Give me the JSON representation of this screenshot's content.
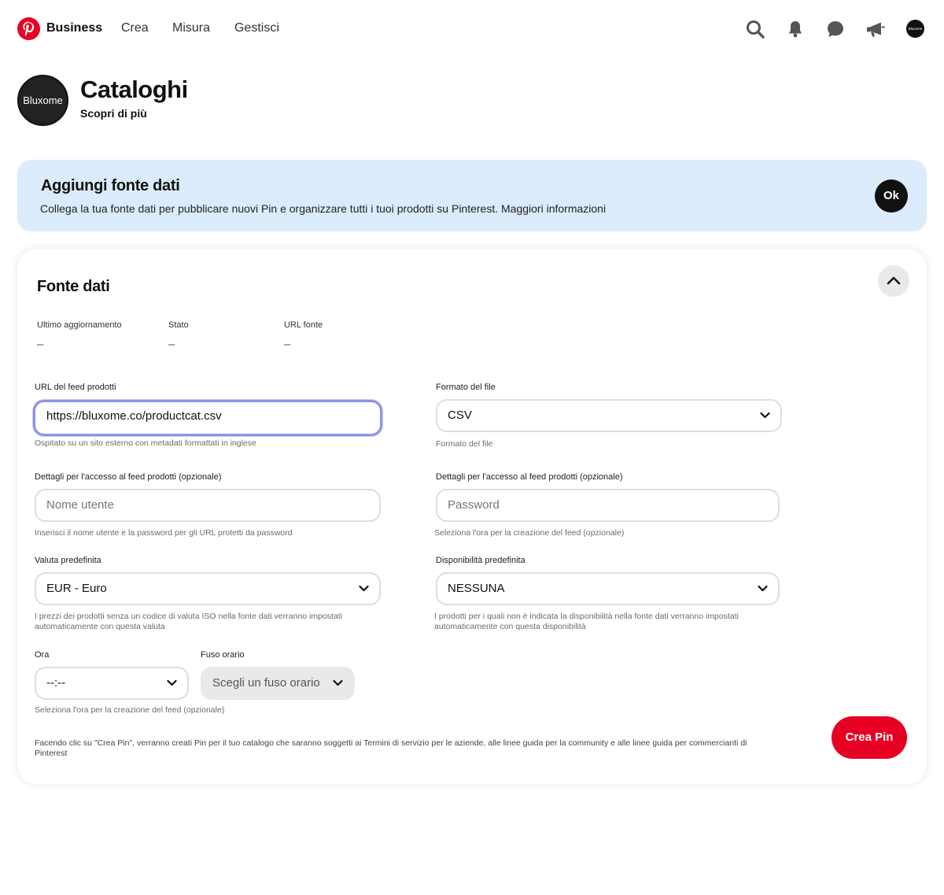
{
  "nav": {
    "business": "Business",
    "crea": "Crea",
    "misura": "Misura",
    "gestisci": "Gestisci",
    "account_avatar_text": "Bluxome"
  },
  "header": {
    "avatar_text": "Bluxome",
    "title": "Cataloghi",
    "subtitle": "Scopri di più"
  },
  "banner": {
    "title": "Aggiungi fonte dati",
    "text": "Collega la tua fonte dati per pubblicare nuovi Pin e organizzare tutti i tuoi prodotti su Pinterest. Maggiori informazioni",
    "ok_label": "Ok"
  },
  "card": {
    "title": "Fonte dati",
    "meta": [
      {
        "label": "Ultimo aggiornamento",
        "value": "–"
      },
      {
        "label": "Stato",
        "value": "–"
      },
      {
        "label": "URL fonte",
        "value": "–"
      }
    ],
    "feed_url": {
      "label": "URL del feed prodotti",
      "value": "https://bluxome.co/productcat.csv",
      "help": "Ospitato su un sito esterno con metadati formattati in inglese"
    },
    "file_format": {
      "label": "Formato del file",
      "value": "CSV",
      "help": "Formato del file"
    },
    "username": {
      "label": "Dettagli per l'accesso al feed prodotti (opzionale)",
      "placeholder": "Nome utente",
      "help": "Inserisci il nome utente e la password per gli URL protetti da password"
    },
    "password": {
      "label": "Dettagli per l'accesso al feed prodotti (opzionale)",
      "placeholder": "Password",
      "help": "Seleziona l'ora per la creazione del feed (opzionale)"
    },
    "currency": {
      "label": "Valuta predefinita",
      "value": "EUR - Euro",
      "help": "I prezzi dei prodotti senza un codice di valuta ISO nella fonte dati verranno impostati automaticamente con questa valuta"
    },
    "availability": {
      "label": "Disponibilità predefinita",
      "value": "NESSUNA",
      "help": "I prodotti per i quali non è indicata la disponibilità nella fonte dati verranno impostati automaticamente con questa disponibilità"
    },
    "time": {
      "label": "Ora",
      "value": "--:--",
      "help": "Seleziona l'ora per la creazione del feed (opzionale)"
    },
    "timezone": {
      "label": "Fuso orario",
      "value": "Scegli un fuso orario"
    },
    "legal": "Facendo clic su \"Crea Pin\", verranno creati Pin per il tuo catalogo che saranno soggetti ai Termini di servizio per le aziende, alle linee guida per la community e alle linee guida per commercianti di Pinterest",
    "submit_label": "Crea Pin"
  },
  "colors": {
    "brand_red": "#e60023",
    "banner_bg": "#dcebfc",
    "focus_ring": "#8f93ea"
  },
  "icons": [
    "pinterest-logo-icon",
    "search-icon",
    "bell-icon",
    "chat-icon",
    "megaphone-icon",
    "chevron-up-icon",
    "chevron-down-icon"
  ]
}
